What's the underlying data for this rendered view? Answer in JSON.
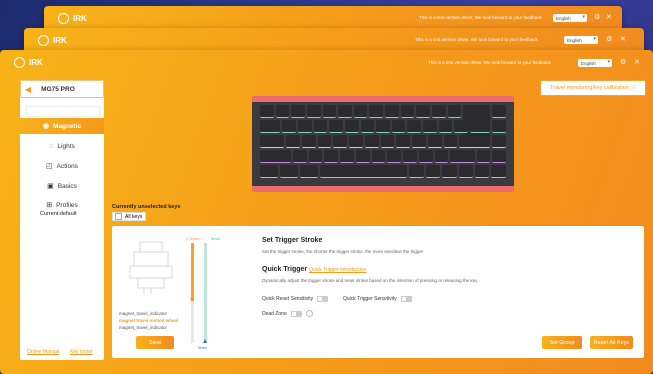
{
  "windows": {
    "logo": "IRK",
    "notice": "This is a test version driver, We look forward to your feedback",
    "language": "English"
  },
  "sidebar": {
    "device_name": "MG75 PRO",
    "items": [
      {
        "label": "Magnetic",
        "icon": "magnet-icon"
      },
      {
        "label": "Lights",
        "icon": "bulb-icon"
      },
      {
        "label": "Actions",
        "icon": "action-icon"
      },
      {
        "label": "Basics",
        "icon": "basics-icon"
      },
      {
        "label": "Profiles",
        "icon": "grid-icon"
      }
    ],
    "profile_default": "Current:default",
    "online_manual": "Online Manual",
    "key_tester": "Key tester"
  },
  "top_button": "Travel monitoring/key calibration",
  "selection": {
    "unselected_label": "Currently unselected keys",
    "all_keys": "All keys"
  },
  "panel": {
    "rail_top_left": "0.00mm",
    "rail_top_right": "0mm",
    "rail_bottom": "0mm",
    "legend": [
      "magnet_travel_indicator",
      "magnet travel motion wheel",
      "magnet_travel_indicator"
    ],
    "save": "Save",
    "set_trigger_title": "Set Trigger Stroke",
    "set_trigger_text": "Set the trigger stroke, the shorter the trigger stroke, the more sensitive the trigger",
    "quick_trigger_title": "Quick Trigger",
    "quick_trigger_link": "Quick Trigger Introduction",
    "quick_trigger_text": "Dynamically adjust the trigger stroke and reset stroke based on the intention of pressing or releasing the key",
    "quick_reset": "Quick Reset Sensitivity",
    "quick_trigger_sens": "Quick Trigger Sensitivity",
    "dead_zone": "Dead Zone",
    "set_group": "Set Group",
    "reset_all": "Reset All Keys"
  },
  "colors": {
    "accent": "#f39a1d",
    "bar_red": "#ee6c6a",
    "key_dark": "#2b2b2e"
  }
}
